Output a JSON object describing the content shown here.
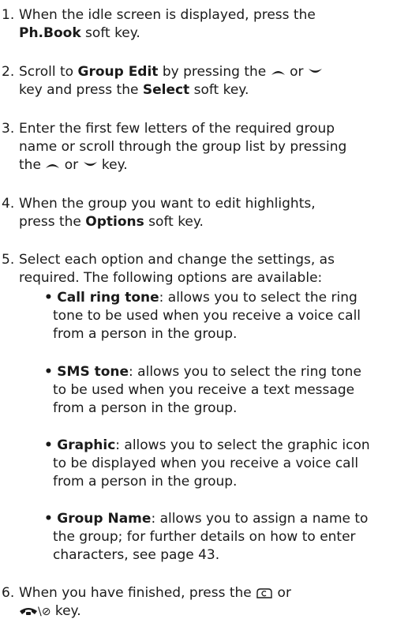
{
  "steps": [
    {
      "num": "1.",
      "lines": [
        [
          "When the idle screen is displayed, press the"
        ],
        [
          "",
          {
            "b": "Ph.Book"
          },
          " soft key."
        ]
      ]
    },
    {
      "num": "2.",
      "line1": {
        "a": "Scroll to ",
        "b": "Group Edit",
        "c": " by pressing the ",
        "d": " or "
      },
      "line2": {
        "a": "key and press the ",
        "b": "Select",
        "c": " soft key."
      }
    },
    {
      "num": "3.",
      "line1": "Enter the first few letters of the required group",
      "line2": "name or scroll through the group list by pressing",
      "line3": {
        "a": "the ",
        "b": " or ",
        "c": " key."
      }
    },
    {
      "num": "4.",
      "line1": "When the group you want to edit highlights,",
      "line2": {
        "a": "press the ",
        "b": "Options",
        "c": " soft key."
      }
    },
    {
      "num": "5.",
      "line1": "Select each option and change the settings, as",
      "line2": "required. The following options are available:"
    },
    {
      "num": "6.",
      "line1": {
        "a": "When you have finished, press the ",
        "b": " or"
      },
      "line2": {
        "a": " key."
      }
    }
  ],
  "bullets": [
    {
      "term": "Call ring tone",
      "line1": ": allows you to select the ring",
      "line2": "tone to be used when you receive a voice call",
      "line3": "from a person in the group."
    },
    {
      "term": "SMS tone",
      "line1": ": allows you to select the ring tone",
      "line2": "to be used when you receive a text message",
      "line3": "from a person in the group."
    },
    {
      "term": "Graphic",
      "line1": ": allows you to select the graphic icon",
      "line2": "to be displayed when you receive a voice call",
      "line3": "from a person in the group."
    },
    {
      "term": "Group Name",
      "line1": ": allows you to assign a name to",
      "line2": "the group; for further details on how to enter",
      "line3": "characters, see page 43."
    }
  ],
  "bullet_char": "•",
  "end_key_suffix": "\\⊘",
  "icons": [
    "up-arrow-key-icon",
    "down-arrow-key-icon",
    "cancel-key-icon",
    "end-power-key-icon"
  ]
}
